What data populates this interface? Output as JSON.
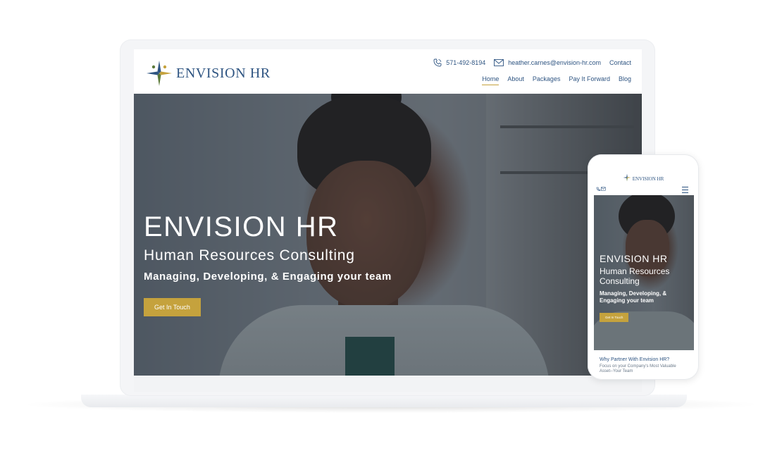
{
  "brand": {
    "name": "ENVISION HR",
    "colors": {
      "navy": "#2f5582",
      "gold": "#c5a23d",
      "green": "#5c7a3a"
    }
  },
  "header": {
    "phone": "571-492-8194",
    "email": "heather.carnes@envision-hr.com",
    "contact_label": "Contact",
    "nav": [
      {
        "label": "Home",
        "active": true
      },
      {
        "label": "About"
      },
      {
        "label": "Packages"
      },
      {
        "label": "Pay It Forward"
      },
      {
        "label": "Blog"
      }
    ]
  },
  "hero": {
    "title": "ENVISION HR",
    "subtitle": "Human Resources Consulting",
    "tagline": "Managing, Developing, & Engaging your team",
    "cta_label": "Get In Touch"
  },
  "mobile": {
    "logo_text": "ENVISION HR",
    "hero": {
      "title": "ENVISION HR",
      "subtitle": "Human Resources Consulting",
      "tagline": "Managing, Developing, & Engaging your team",
      "cta_label": "Get In Touch"
    },
    "why_title": "Why Partner With Envision HR?",
    "why_subtitle": "Focus on your Company's Most Valuable Asset--Your Team"
  }
}
